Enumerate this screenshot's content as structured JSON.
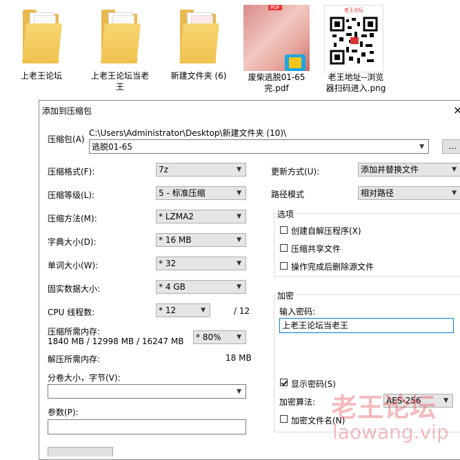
{
  "desktop": {
    "icons": [
      {
        "label": "上老王论坛"
      },
      {
        "label": "上老王论坛当老王"
      },
      {
        "label": "新建文件夹 (6)"
      },
      {
        "label": "废柴逃脱01-65完.pdf",
        "badge": "PDF"
      },
      {
        "label": "老王地址--浏览器扫码进入.png",
        "badge": "老王论坛"
      }
    ]
  },
  "dialog": {
    "title": "添加到压缩包",
    "close_icon": "×",
    "archive_label": "压缩包(A)",
    "archive_path": "C:\\Users\\Administrator\\Desktop\\新建文件夹 (10)\\",
    "archive_name": "逃脱01-65",
    "browse_label": "...",
    "format": {
      "label": "压缩格式(F):",
      "value": "7z"
    },
    "level": {
      "label": "压缩等级(L):",
      "value": "5 - 标准压缩"
    },
    "method": {
      "label": "压缩方法(M):",
      "value": "*  LZMA2"
    },
    "dict": {
      "label": "字典大小(D):",
      "value": "*  16 MB"
    },
    "word": {
      "label": "单词大小(W):",
      "value": "*  32"
    },
    "solid": {
      "label": "固实数据大小:",
      "value": "*  4 GB"
    },
    "threads": {
      "label": "CPU 线程数:",
      "value": "*  12",
      "total": "/ 12"
    },
    "mem_compress": {
      "label": "压缩所需内存:",
      "detail": "1840 MB / 12998 MB / 16247 MB",
      "value": "*  80%"
    },
    "mem_decompress": {
      "label": "解压所需内存:",
      "value": "18 MB"
    },
    "volume": {
      "label": "分卷大小，字节(V):",
      "value": ""
    },
    "params": {
      "label": "参数(P):",
      "value": ""
    },
    "update": {
      "label": "更新方式(U):",
      "value": "添加并替换文件"
    },
    "path_mode": {
      "label": "路径模式",
      "value": "相对路径"
    },
    "options": {
      "title": "选项",
      "items": [
        {
          "label": "创建自解压程序(X)",
          "checked": false
        },
        {
          "label": "压缩共享文件",
          "checked": false
        },
        {
          "label": "操作完成后删除源文件",
          "checked": false
        }
      ]
    },
    "encryption": {
      "title": "加密",
      "password_label": "输入密码:",
      "password_value": "上老王论坛当老王",
      "show_password": {
        "label": "显示密码(S)",
        "checked": true
      },
      "algo_label": "加密算法:",
      "algo_value": "AES-256",
      "encrypt_names": {
        "label": "加密文件名(N)",
        "checked": false
      }
    }
  },
  "watermark": {
    "line1": "老王论坛",
    "line2": "laowang.vip"
  },
  "colors": {
    "folder": "#e9b94f",
    "focus_border": "#0078d7",
    "watermark": "#dc3c46"
  }
}
